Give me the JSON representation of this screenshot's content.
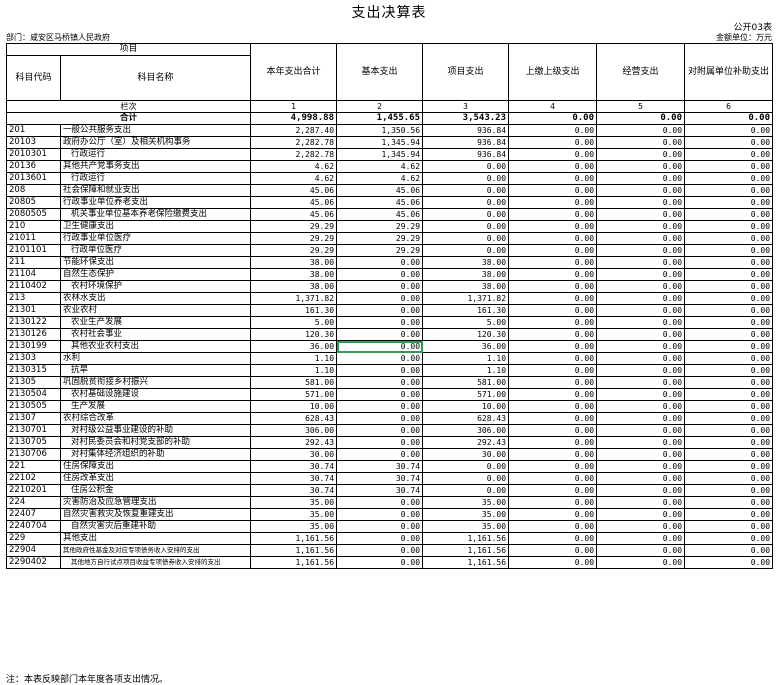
{
  "title": "支出决算表",
  "table_code": "公开03表",
  "department": "部门：咸安区马桥镇人民政府",
  "unit": "金额单位：万元",
  "headers": {
    "item_group": "项目",
    "code": "科目代码",
    "name": "科目名称",
    "c1": "本年支出合计",
    "c2": "基本支出",
    "c3": "项目支出",
    "c4": "上缴上级支出",
    "c5": "经营支出",
    "c6": "对附属单位补助支出"
  },
  "index_row": {
    "label": "栏次",
    "c1": "1",
    "c2": "2",
    "c3": "3",
    "c4": "4",
    "c5": "5",
    "c6": "6"
  },
  "total_row": {
    "label": "合计",
    "c1": "4,998.88",
    "c2": "1,455.65",
    "c3": "3,543.23",
    "c4": "0.00",
    "c5": "0.00",
    "c6": "0.00"
  },
  "rows": [
    {
      "code": "201",
      "name": "一般公共服务支出",
      "lvl": 0,
      "c1": "2,287.40",
      "c2": "1,350.56",
      "c3": "936.84",
      "c4": "0.00",
      "c5": "0.00",
      "c6": "0.00"
    },
    {
      "code": "20103",
      "name": "政府办公厅（室）及相关机构事务",
      "lvl": 0,
      "c1": "2,282.78",
      "c2": "1,345.94",
      "c3": "936.84",
      "c4": "0.00",
      "c5": "0.00",
      "c6": "0.00"
    },
    {
      "code": "2010301",
      "name": "行政运行",
      "lvl": 1,
      "c1": "2,282.78",
      "c2": "1,345.94",
      "c3": "936.84",
      "c4": "0.00",
      "c5": "0.00",
      "c6": "0.00"
    },
    {
      "code": "20136",
      "name": "其他共产党事务支出",
      "lvl": 0,
      "c1": "4.62",
      "c2": "4.62",
      "c3": "0.00",
      "c4": "0.00",
      "c5": "0.00",
      "c6": "0.00"
    },
    {
      "code": "2013601",
      "name": "行政运行",
      "lvl": 1,
      "c1": "4.62",
      "c2": "4.62",
      "c3": "0.00",
      "c4": "0.00",
      "c5": "0.00",
      "c6": "0.00"
    },
    {
      "code": "208",
      "name": "社会保障和就业支出",
      "lvl": 0,
      "c1": "45.06",
      "c2": "45.06",
      "c3": "0.00",
      "c4": "0.00",
      "c5": "0.00",
      "c6": "0.00"
    },
    {
      "code": "20805",
      "name": "行政事业单位养老支出",
      "lvl": 0,
      "c1": "45.06",
      "c2": "45.06",
      "c3": "0.00",
      "c4": "0.00",
      "c5": "0.00",
      "c6": "0.00"
    },
    {
      "code": "2080505",
      "name": "机关事业单位基本养老保险缴费支出",
      "lvl": 1,
      "c1": "45.06",
      "c2": "45.06",
      "c3": "0.00",
      "c4": "0.00",
      "c5": "0.00",
      "c6": "0.00"
    },
    {
      "code": "210",
      "name": "卫生健康支出",
      "lvl": 0,
      "c1": "29.29",
      "c2": "29.29",
      "c3": "0.00",
      "c4": "0.00",
      "c5": "0.00",
      "c6": "0.00"
    },
    {
      "code": "21011",
      "name": "行政事业单位医疗",
      "lvl": 0,
      "c1": "29.29",
      "c2": "29.29",
      "c3": "0.00",
      "c4": "0.00",
      "c5": "0.00",
      "c6": "0.00"
    },
    {
      "code": "2101101",
      "name": "行政单位医疗",
      "lvl": 1,
      "c1": "29.29",
      "c2": "29.29",
      "c3": "0.00",
      "c4": "0.00",
      "c5": "0.00",
      "c6": "0.00"
    },
    {
      "code": "211",
      "name": "节能环保支出",
      "lvl": 0,
      "c1": "38.00",
      "c2": "0.00",
      "c3": "38.00",
      "c4": "0.00",
      "c5": "0.00",
      "c6": "0.00"
    },
    {
      "code": "21104",
      "name": "自然生态保护",
      "lvl": 0,
      "c1": "38.00",
      "c2": "0.00",
      "c3": "38.00",
      "c4": "0.00",
      "c5": "0.00",
      "c6": "0.00"
    },
    {
      "code": "2110402",
      "name": "农村环境保护",
      "lvl": 1,
      "c1": "38.00",
      "c2": "0.00",
      "c3": "38.00",
      "c4": "0.00",
      "c5": "0.00",
      "c6": "0.00"
    },
    {
      "code": "213",
      "name": "农林水支出",
      "lvl": 0,
      "c1": "1,371.82",
      "c2": "0.00",
      "c3": "1,371.82",
      "c4": "0.00",
      "c5": "0.00",
      "c6": "0.00"
    },
    {
      "code": "21301",
      "name": "农业农村",
      "lvl": 0,
      "c1": "161.30",
      "c2": "0.00",
      "c3": "161.30",
      "c4": "0.00",
      "c5": "0.00",
      "c6": "0.00"
    },
    {
      "code": "2130122",
      "name": "农业生产发展",
      "lvl": 1,
      "c1": "5.00",
      "c2": "0.00",
      "c3": "5.00",
      "c4": "0.00",
      "c5": "0.00",
      "c6": "0.00"
    },
    {
      "code": "2130126",
      "name": "农村社会事业",
      "lvl": 1,
      "c1": "120.30",
      "c2": "0.00",
      "c3": "120.30",
      "c4": "0.00",
      "c5": "0.00",
      "c6": "0.00"
    },
    {
      "code": "2130199",
      "name": "其他农业农村支出",
      "lvl": 1,
      "c1": "36.00",
      "c2": "0.00",
      "c3": "36.00",
      "c4": "0.00",
      "c5": "0.00",
      "c6": "0.00",
      "sel": "c2"
    },
    {
      "code": "21303",
      "name": "水利",
      "lvl": 0,
      "c1": "1.10",
      "c2": "0.00",
      "c3": "1.10",
      "c4": "0.00",
      "c5": "0.00",
      "c6": "0.00"
    },
    {
      "code": "2130315",
      "name": "抗旱",
      "lvl": 1,
      "c1": "1.10",
      "c2": "0.00",
      "c3": "1.10",
      "c4": "0.00",
      "c5": "0.00",
      "c6": "0.00"
    },
    {
      "code": "21305",
      "name": "巩固脱贫衔接乡村振兴",
      "lvl": 0,
      "c1": "581.00",
      "c2": "0.00",
      "c3": "581.00",
      "c4": "0.00",
      "c5": "0.00",
      "c6": "0.00"
    },
    {
      "code": "2130504",
      "name": "农村基础设施建设",
      "lvl": 1,
      "c1": "571.00",
      "c2": "0.00",
      "c3": "571.00",
      "c4": "0.00",
      "c5": "0.00",
      "c6": "0.00"
    },
    {
      "code": "2130505",
      "name": "生产发展",
      "lvl": 1,
      "c1": "10.00",
      "c2": "0.00",
      "c3": "10.00",
      "c4": "0.00",
      "c5": "0.00",
      "c6": "0.00"
    },
    {
      "code": "21307",
      "name": "农村综合改革",
      "lvl": 0,
      "c1": "628.43",
      "c2": "0.00",
      "c3": "628.43",
      "c4": "0.00",
      "c5": "0.00",
      "c6": "0.00"
    },
    {
      "code": "2130701",
      "name": "对村级公益事业建设的补助",
      "lvl": 1,
      "c1": "306.00",
      "c2": "0.00",
      "c3": "306.00",
      "c4": "0.00",
      "c5": "0.00",
      "c6": "0.00"
    },
    {
      "code": "2130705",
      "name": "对村民委员会和村党支部的补助",
      "lvl": 1,
      "c1": "292.43",
      "c2": "0.00",
      "c3": "292.43",
      "c4": "0.00",
      "c5": "0.00",
      "c6": "0.00"
    },
    {
      "code": "2130706",
      "name": "对村集体经济组织的补助",
      "lvl": 1,
      "c1": "30.00",
      "c2": "0.00",
      "c3": "30.00",
      "c4": "0.00",
      "c5": "0.00",
      "c6": "0.00"
    },
    {
      "code": "221",
      "name": "住房保障支出",
      "lvl": 0,
      "c1": "30.74",
      "c2": "30.74",
      "c3": "0.00",
      "c4": "0.00",
      "c5": "0.00",
      "c6": "0.00"
    },
    {
      "code": "22102",
      "name": "住房改革支出",
      "lvl": 0,
      "c1": "30.74",
      "c2": "30.74",
      "c3": "0.00",
      "c4": "0.00",
      "c5": "0.00",
      "c6": "0.00"
    },
    {
      "code": "2210201",
      "name": "住房公积金",
      "lvl": 1,
      "c1": "30.74",
      "c2": "30.74",
      "c3": "0.00",
      "c4": "0.00",
      "c5": "0.00",
      "c6": "0.00"
    },
    {
      "code": "224",
      "name": "灾害防治及应急管理支出",
      "lvl": 0,
      "c1": "35.00",
      "c2": "0.00",
      "c3": "35.00",
      "c4": "0.00",
      "c5": "0.00",
      "c6": "0.00"
    },
    {
      "code": "22407",
      "name": "自然灾害救灾及恢复重建支出",
      "lvl": 0,
      "c1": "35.00",
      "c2": "0.00",
      "c3": "35.00",
      "c4": "0.00",
      "c5": "0.00",
      "c6": "0.00"
    },
    {
      "code": "2240704",
      "name": "自然灾害灾后重建补助",
      "lvl": 1,
      "c1": "35.00",
      "c2": "0.00",
      "c3": "35.00",
      "c4": "0.00",
      "c5": "0.00",
      "c6": "0.00"
    },
    {
      "code": "229",
      "name": "其他支出",
      "lvl": 0,
      "c1": "1,161.56",
      "c2": "0.00",
      "c3": "1,161.56",
      "c4": "0.00",
      "c5": "0.00",
      "c6": "0.00"
    },
    {
      "code": "22904",
      "name": "其他政府性基金及对应专项债务收入安排的支出",
      "lvl": 0,
      "small": true,
      "c1": "1,161.56",
      "c2": "0.00",
      "c3": "1,161.56",
      "c4": "0.00",
      "c5": "0.00",
      "c6": "0.00"
    },
    {
      "code": "2290402",
      "name": "其他地方自行试点项目收益专项债券收入安排的支出",
      "lvl": 1,
      "small": true,
      "c1": "1,161.56",
      "c2": "0.00",
      "c3": "1,161.56",
      "c4": "0.00",
      "c5": "0.00",
      "c6": "0.00"
    }
  ],
  "note": "注：本表反映部门本年度各项支出情况。"
}
